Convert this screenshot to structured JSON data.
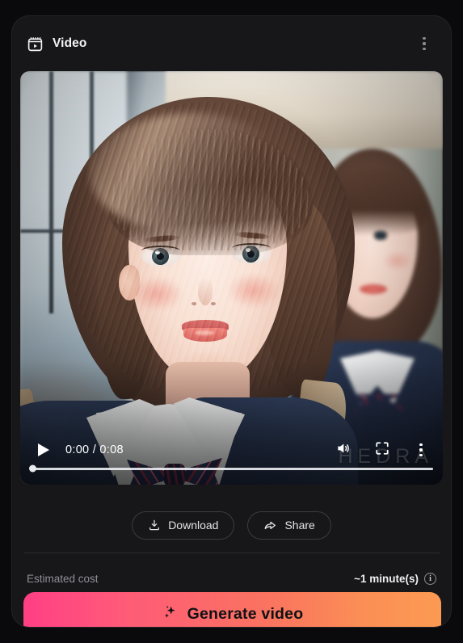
{
  "card": {
    "header": {
      "title": "Video",
      "icon": "video-clip-icon",
      "menu_icon": "more-vertical-icon"
    },
    "player": {
      "play_icon": "play-icon",
      "current_time": "0:00",
      "separator": "/",
      "duration": "0:08",
      "time_display": "0:00 / 0:08",
      "volume_icon": "volume-on-icon",
      "fullscreen_icon": "fullscreen-icon",
      "settings_icon": "more-vertical-icon",
      "progress_percent": 1,
      "watermark": "HEDRA"
    },
    "actions": [
      {
        "label": "Download",
        "icon": "download-icon"
      },
      {
        "label": "Share",
        "icon": "share-arrow-icon"
      }
    ],
    "cost": {
      "label": "Estimated cost",
      "value": "~1 minute(s)",
      "info_icon": "info-icon",
      "info_glyph": "i"
    },
    "generate": {
      "label": "Generate video",
      "icon": "sparkle-icon",
      "gradient_start": "#ff3f85",
      "gradient_end": "#fb9a52"
    }
  },
  "theme": {
    "page_background": "#0a0a0c",
    "card_background": "#17171a",
    "card_border": "#242428",
    "text_primary": "#f4f4f6",
    "text_muted": "#8e8e97",
    "divider": "#2a2a2f"
  }
}
